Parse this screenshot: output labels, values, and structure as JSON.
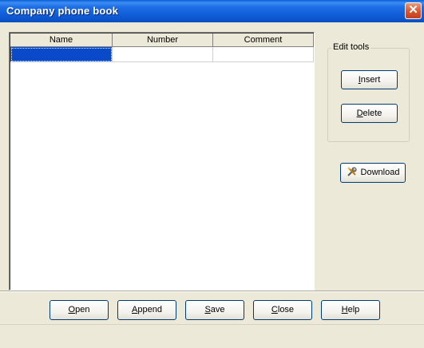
{
  "window": {
    "title": "Company phone book",
    "close_glyph": "✕"
  },
  "grid": {
    "columns": [
      "Name",
      "Number",
      "Comment"
    ],
    "rows": [
      {
        "name": "",
        "number": "",
        "comment": ""
      }
    ],
    "selected_row": 0,
    "selected_col": 0
  },
  "edit_tools": {
    "group_label": "Edit tools",
    "insert_underline": "I",
    "insert_rest": "nsert",
    "delete_underline": "D",
    "delete_rest": "elete"
  },
  "download": {
    "label": "Download",
    "icon": "wrench-screwdriver-icon"
  },
  "bottom_buttons": {
    "open_u": "O",
    "open_rest": "pen",
    "append_u": "A",
    "append_rest": "ppend",
    "save_u": "S",
    "save_rest": "ave",
    "close_u": "C",
    "close_rest": "lose",
    "help_u": "H",
    "help_rest": "elp"
  },
  "colors": {
    "selection": "#0a49c9",
    "titlebar": "#0a5fd8",
    "face": "#ece9d8"
  }
}
